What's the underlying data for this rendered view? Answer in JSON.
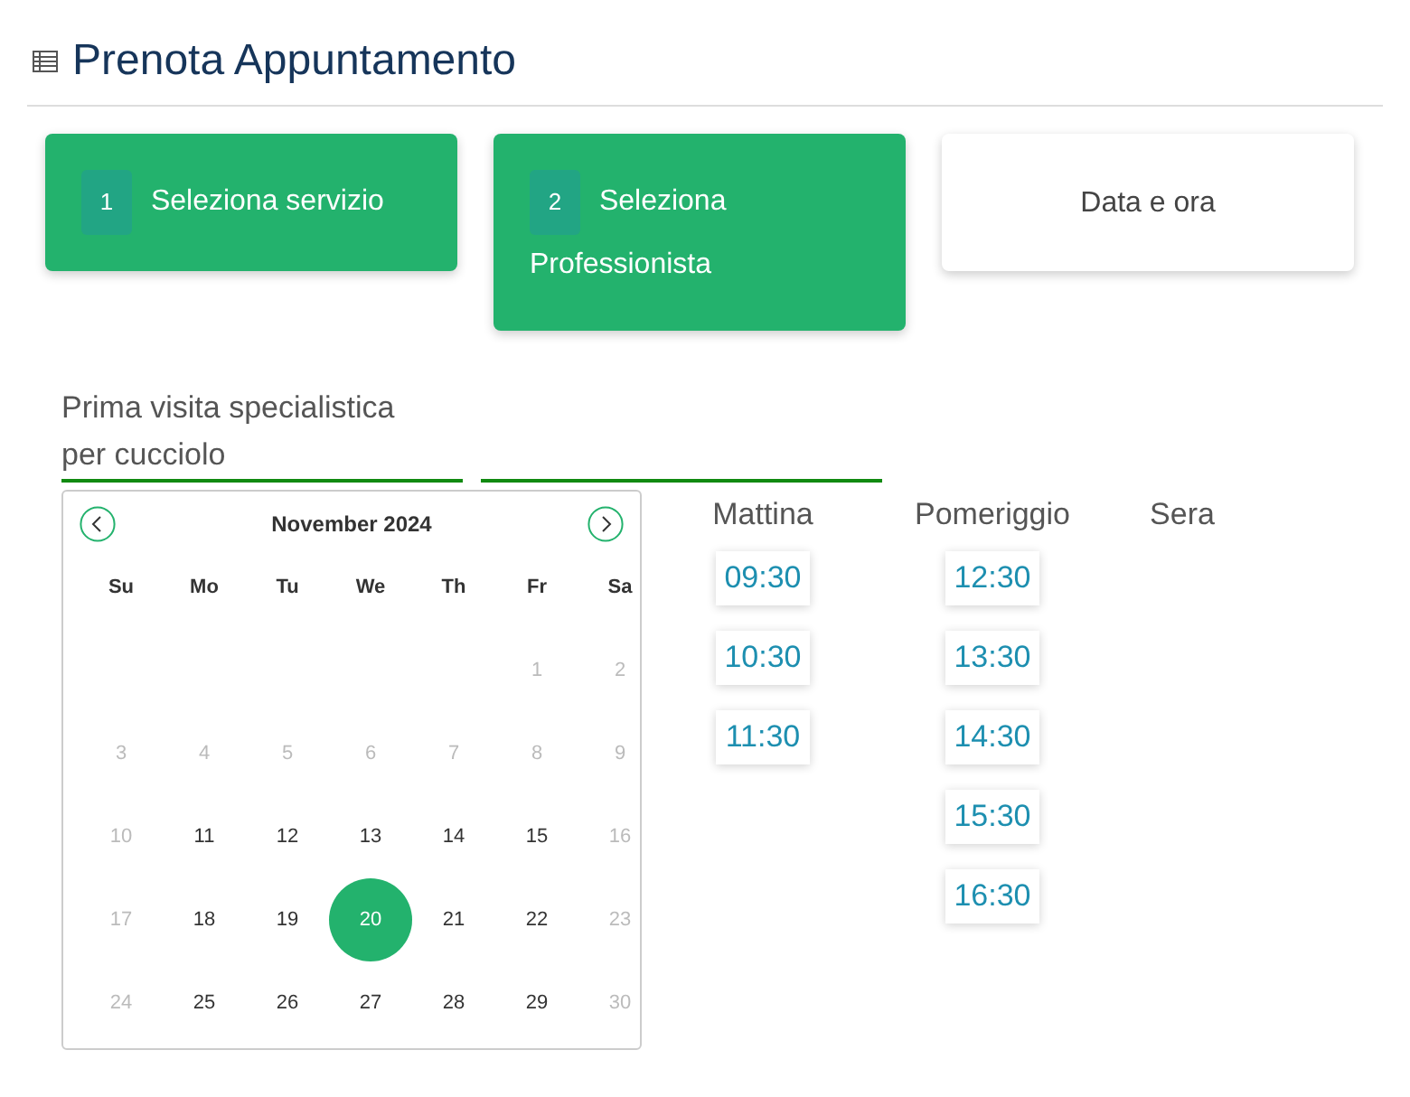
{
  "title": "Prenota Appuntamento",
  "steps": [
    {
      "number": "1",
      "label": "Seleziona servizio",
      "completed": true
    },
    {
      "number": "2",
      "label": "Seleziona Professionista",
      "completed": true
    },
    {
      "label": "Data e ora",
      "completed": false
    }
  ],
  "service": {
    "value": "Prima visita specialistica per cucciolo"
  },
  "calendar": {
    "month": "November 2024",
    "weekdays": [
      "Su",
      "Mo",
      "Tu",
      "We",
      "Th",
      "Fr",
      "Sa"
    ],
    "weeks": [
      [
        {
          "day": "1",
          "disabled": true,
          "selected": false
        },
        {
          "day": "2",
          "disabled": true,
          "selected": false
        }
      ],
      [
        {
          "day": "3",
          "disabled": true,
          "selected": false
        },
        {
          "day": "4",
          "disabled": true,
          "selected": false
        },
        {
          "day": "5",
          "disabled": true,
          "selected": false
        },
        {
          "day": "6",
          "disabled": true,
          "selected": false
        },
        {
          "day": "7",
          "disabled": true,
          "selected": false
        },
        {
          "day": "8",
          "disabled": true,
          "selected": false
        },
        {
          "day": "9",
          "disabled": true,
          "selected": false
        }
      ],
      [
        {
          "day": "10",
          "disabled": true,
          "selected": false
        },
        {
          "day": "11",
          "disabled": false,
          "selected": false
        },
        {
          "day": "12",
          "disabled": false,
          "selected": false
        },
        {
          "day": "13",
          "disabled": false,
          "selected": false
        },
        {
          "day": "14",
          "disabled": false,
          "selected": false
        },
        {
          "day": "15",
          "disabled": false,
          "selected": false
        },
        {
          "day": "16",
          "disabled": true,
          "selected": false
        }
      ],
      [
        {
          "day": "17",
          "disabled": true,
          "selected": false
        },
        {
          "day": "18",
          "disabled": false,
          "selected": false
        },
        {
          "day": "19",
          "disabled": false,
          "selected": false
        },
        {
          "day": "20",
          "disabled": false,
          "selected": true
        },
        {
          "day": "21",
          "disabled": false,
          "selected": false
        },
        {
          "day": "22",
          "disabled": false,
          "selected": false
        },
        {
          "day": "23",
          "disabled": true,
          "selected": false
        }
      ],
      [
        {
          "day": "24",
          "disabled": true,
          "selected": false
        },
        {
          "day": "25",
          "disabled": false,
          "selected": false
        },
        {
          "day": "26",
          "disabled": false,
          "selected": false
        },
        {
          "day": "27",
          "disabled": false,
          "selected": false
        },
        {
          "day": "28",
          "disabled": false,
          "selected": false
        },
        {
          "day": "29",
          "disabled": false,
          "selected": false
        },
        {
          "day": "30",
          "disabled": true,
          "selected": false
        }
      ]
    ]
  },
  "slots": [
    {
      "label": "Mattina",
      "times": [
        "09:30",
        "10:30",
        "11:30"
      ]
    },
    {
      "label": "Pomeriggio",
      "times": [
        "12:30",
        "13:30",
        "14:30",
        "15:30",
        "16:30"
      ]
    },
    {
      "label": "Sera"
    }
  ]
}
